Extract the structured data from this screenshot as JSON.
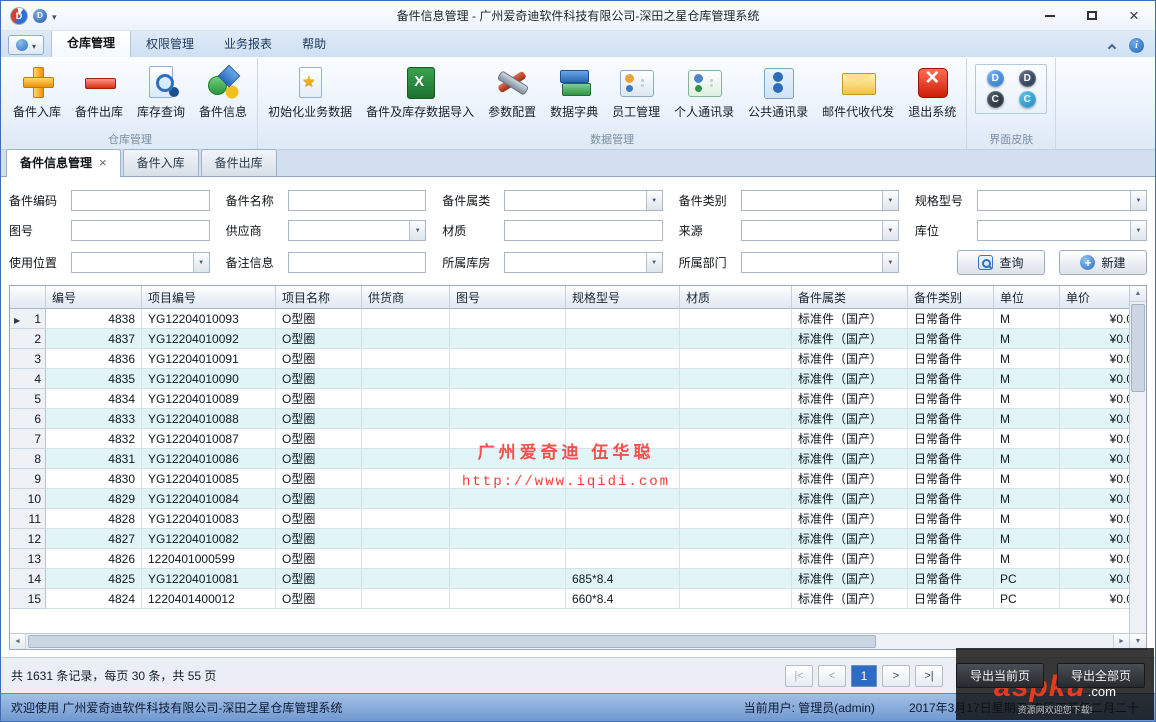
{
  "window": {
    "title": "备件信息管理 - 广州爱奇迪软件科技有限公司-深田之星仓库管理系统"
  },
  "ribbon": {
    "tabs": [
      {
        "label": "仓库管理",
        "name": "warehouse",
        "active": true
      },
      {
        "label": "权限管理",
        "name": "permission",
        "active": false
      },
      {
        "label": "业务报表",
        "name": "business-report",
        "active": false
      },
      {
        "label": "帮助",
        "name": "help",
        "active": false
      }
    ],
    "groups": [
      {
        "label": "仓库管理",
        "name": "warehouse-group",
        "items": [
          {
            "label": "备件入库",
            "name": "parts-inbound",
            "icon": "add-icon"
          },
          {
            "label": "备件出库",
            "name": "parts-outbound",
            "icon": "remove-icon"
          },
          {
            "label": "库存查询",
            "name": "stock-query",
            "icon": "stock-search-icon"
          },
          {
            "label": "备件信息",
            "name": "parts-info",
            "icon": "parts-info-icon"
          }
        ]
      },
      {
        "label": "数据管理",
        "name": "data-group",
        "items": [
          {
            "label": "初始化业务数据",
            "name": "init-business-data",
            "icon": "init-data-icon"
          },
          {
            "label": "备件及库存数据导入",
            "name": "parts-stock-import",
            "icon": "excel-import-icon"
          },
          {
            "label": "参数配置",
            "name": "parameter-config",
            "icon": "settings-icon"
          },
          {
            "label": "数据字典",
            "name": "data-dictionary",
            "icon": "dictionary-icon"
          },
          {
            "label": "员工管理",
            "name": "employee-management",
            "icon": "employee-icon"
          },
          {
            "label": "个人通讯录",
            "name": "personal-contacts",
            "icon": "personal-contacts-icon"
          },
          {
            "label": "公共通讯录",
            "name": "public-contacts",
            "icon": "public-contacts-icon"
          },
          {
            "label": "邮件代收代发",
            "name": "mail-proxy",
            "icon": "mail-icon"
          },
          {
            "label": "退出系统",
            "name": "exit-system",
            "icon": "exit-icon"
          }
        ]
      },
      {
        "label": "界面皮肤",
        "name": "skin-group",
        "items": []
      }
    ]
  },
  "skins": [
    {
      "name": "skin-blue",
      "cls": "skin-1"
    },
    {
      "name": "skin-navy",
      "cls": "skin-2"
    },
    {
      "name": "skin-dark",
      "cls": "skin-3"
    },
    {
      "name": "skin-cyan",
      "cls": "skin-4"
    }
  ],
  "doc_tabs": [
    {
      "label": "备件信息管理",
      "name": "parts-info-management",
      "active": true,
      "closable": true
    },
    {
      "label": "备件入库",
      "name": "parts-inbound",
      "active": false,
      "closable": false
    },
    {
      "label": "备件出库",
      "name": "parts-outbound",
      "active": false,
      "closable": false
    }
  ],
  "filter": {
    "fields": [
      {
        "label": "备件编码",
        "name": "part-code",
        "type": "text",
        "value": ""
      },
      {
        "label": "备件名称",
        "name": "part-name",
        "type": "text",
        "value": ""
      },
      {
        "label": "备件属类",
        "name": "part-category",
        "type": "select",
        "value": ""
      },
      {
        "label": "备件类别",
        "name": "part-type",
        "type": "select",
        "value": ""
      },
      {
        "label": "规格型号",
        "name": "spec-model",
        "type": "select",
        "value": ""
      },
      {
        "label": "图号",
        "name": "drawing-no",
        "type": "text",
        "value": ""
      },
      {
        "label": "供应商",
        "name": "supplier",
        "type": "select",
        "value": ""
      },
      {
        "label": "材质",
        "name": "material",
        "type": "text",
        "value": ""
      },
      {
        "label": "来源",
        "name": "source",
        "type": "select",
        "value": ""
      },
      {
        "label": "库位",
        "name": "stock-location",
        "type": "select",
        "value": ""
      },
      {
        "label": "使用位置",
        "name": "usage-position",
        "type": "select",
        "value": ""
      },
      {
        "label": "备注信息",
        "name": "remark",
        "type": "text",
        "value": ""
      },
      {
        "label": "所属库房",
        "name": "warehouse",
        "type": "select",
        "value": ""
      },
      {
        "label": "所属部门",
        "name": "department",
        "type": "select",
        "value": ""
      }
    ],
    "buttons": [
      {
        "label": "查询",
        "name": "query",
        "icon": "search-icon"
      },
      {
        "label": "新建",
        "name": "create",
        "icon": "new-icon"
      }
    ]
  },
  "grid": {
    "columns": [
      "编号",
      "项目编号",
      "项目名称",
      "供货商",
      "图号",
      "规格型号",
      "材质",
      "备件属类",
      "备件类别",
      "单位",
      "单价"
    ],
    "column_names": [
      "id",
      "project-no",
      "project-name",
      "supplier",
      "drawing-no",
      "spec-model",
      "material",
      "category",
      "type",
      "unit",
      "price"
    ],
    "rows": [
      {
        "num": "1",
        "selected": true,
        "cells": [
          "4838",
          "YG12204010093",
          "O型圈",
          "",
          "",
          "",
          "",
          "标准件（国产）",
          "日常备件",
          "M",
          "¥0.0"
        ]
      },
      {
        "num": "2",
        "cells": [
          "4837",
          "YG12204010092",
          "O型圈",
          "",
          "",
          "",
          "",
          "标准件（国产）",
          "日常备件",
          "M",
          "¥0.0"
        ]
      },
      {
        "num": "3",
        "cells": [
          "4836",
          "YG12204010091",
          "O型圈",
          "",
          "",
          "",
          "",
          "标准件（国产）",
          "日常备件",
          "M",
          "¥0.0"
        ]
      },
      {
        "num": "4",
        "cells": [
          "4835",
          "YG12204010090",
          "O型圈",
          "",
          "",
          "",
          "",
          "标准件（国产）",
          "日常备件",
          "M",
          "¥0.0"
        ]
      },
      {
        "num": "5",
        "cells": [
          "4834",
          "YG12204010089",
          "O型圈",
          "",
          "",
          "",
          "",
          "标准件（国产）",
          "日常备件",
          "M",
          "¥0.0"
        ]
      },
      {
        "num": "6",
        "cells": [
          "4833",
          "YG12204010088",
          "O型圈",
          "",
          "",
          "",
          "",
          "标准件（国产）",
          "日常备件",
          "M",
          "¥0.0"
        ]
      },
      {
        "num": "7",
        "cells": [
          "4832",
          "YG12204010087",
          "O型圈",
          "",
          "",
          "",
          "",
          "标准件（国产）",
          "日常备件",
          "M",
          "¥0.0"
        ]
      },
      {
        "num": "8",
        "cells": [
          "4831",
          "YG12204010086",
          "O型圈",
          "",
          "",
          "",
          "",
          "标准件（国产）",
          "日常备件",
          "M",
          "¥0.0"
        ]
      },
      {
        "num": "9",
        "cells": [
          "4830",
          "YG12204010085",
          "O型圈",
          "",
          "",
          "",
          "",
          "标准件（国产）",
          "日常备件",
          "M",
          "¥0.0"
        ]
      },
      {
        "num": "10",
        "cells": [
          "4829",
          "YG12204010084",
          "O型圈",
          "",
          "",
          "",
          "",
          "标准件（国产）",
          "日常备件",
          "M",
          "¥0.0"
        ]
      },
      {
        "num": "11",
        "cells": [
          "4828",
          "YG12204010083",
          "O型圈",
          "",
          "",
          "",
          "",
          "标准件（国产）",
          "日常备件",
          "M",
          "¥0.0"
        ]
      },
      {
        "num": "12",
        "cells": [
          "4827",
          "YG12204010082",
          "O型圈",
          "",
          "",
          "",
          "",
          "标准件（国产）",
          "日常备件",
          "M",
          "¥0.0"
        ]
      },
      {
        "num": "13",
        "cells": [
          "4826",
          "1220401000599",
          "O型圈",
          "",
          "",
          "",
          "",
          "标准件（国产）",
          "日常备件",
          "M",
          "¥0.0"
        ]
      },
      {
        "num": "14",
        "cells": [
          "4825",
          "YG12204010081",
          "O型圈",
          "",
          "",
          "685*8.4",
          "",
          "标准件（国产）",
          "日常备件",
          "PC",
          "¥0.0"
        ]
      },
      {
        "num": "15",
        "cells": [
          "4824",
          "1220401400012",
          "O型圈",
          "",
          "",
          "660*8.4",
          "",
          "标准件（国产）",
          "日常备件",
          "PC",
          "¥0.0"
        ]
      }
    ]
  },
  "watermark": {
    "line1": "广州爱奇迪 伍华聪",
    "line2": "http://www.iqidi.com"
  },
  "pager": {
    "summary": "共 1631 条记录，每页 30 条，共 55 页",
    "first": "|<",
    "prev": "<",
    "page": "1",
    "next": ">",
    "last": ">|",
    "export_current": "导出当前页",
    "export_all": "导出全部页"
  },
  "statusbar": {
    "welcome": "欢迎使用 广州爱奇迪软件科技有限公司-深田之星仓库管理系统",
    "user": "当前用户: 管理员(admin)",
    "date": "2017年3月17日星期五 农历丁酉年二月二十"
  },
  "overlay": {
    "brand": "aspku",
    "domain": ".com",
    "caption": "资源网欢迎您下载!"
  }
}
